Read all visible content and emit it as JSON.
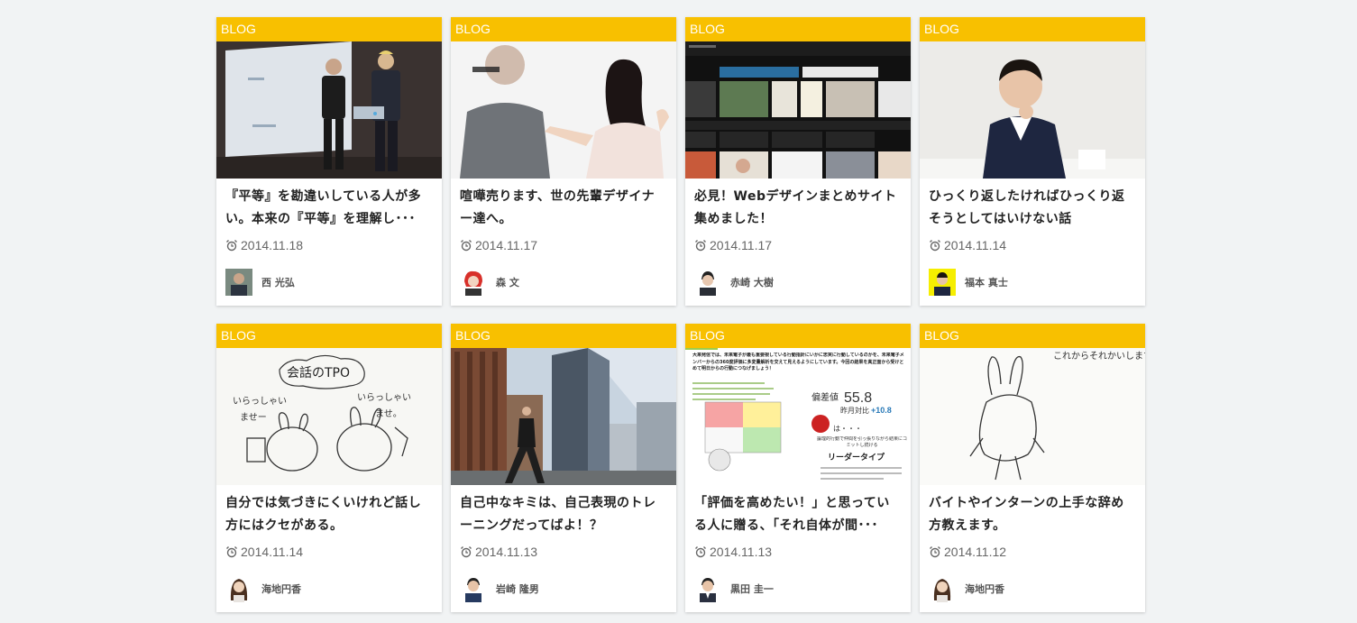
{
  "cards": [
    {
      "category": "BLOG",
      "title": "『平等』を勘違いしている人が多い。本来の『平等』を理解し･･･",
      "date": "2014.11.18",
      "author": "西 光弘",
      "thumb_icon": "presentation-photo"
    },
    {
      "category": "BLOG",
      "title": "喧嘩売ります、世の先輩デザイナー達へ。",
      "date": "2014.11.17",
      "author": "森 文",
      "thumb_icon": "argument-photo"
    },
    {
      "category": "BLOG",
      "title": "必見！Webデザインまとめサイト集めました！",
      "date": "2014.11.17",
      "author": "赤崎 大樹",
      "thumb_icon": "website-screenshot"
    },
    {
      "category": "BLOG",
      "title": "ひっくり返したければひっくり返そうとしてはいけない話",
      "date": "2014.11.14",
      "author": "福本 真士",
      "thumb_icon": "portrait-photo"
    },
    {
      "category": "BLOG",
      "title": "自分では気づきにくいけれど話し方にはクセがある。",
      "date": "2014.11.14",
      "author": "海地円香",
      "thumb_icon": "sketch-illustration",
      "thumb_text": [
        "会話のTPO",
        "いらっしゃい",
        "ませー",
        "いらっしゃい",
        "ませ。"
      ]
    },
    {
      "category": "BLOG",
      "title": "自己中なキミは、自己表現のトレーニングだってばよ！？",
      "date": "2014.11.13",
      "author": "岩崎 隆男",
      "thumb_icon": "city-building-photo"
    },
    {
      "category": "BLOG",
      "title": "「評価を高めたい！」と思っている人に贈る、「それ自体が間･･･",
      "date": "2014.11.13",
      "author": "黒田 圭一",
      "thumb_icon": "evaluation-report",
      "thumb_text": [
        "大来発信では、未来電子が最も重要視している行動指針にいかに忠実に行動しているのかを、未来電子メンバーからの360度評価に多変量解析を交えて見えるようにしています。今回の結果を真正面から受けとめて明日からの行動につなげましょう！",
        "偏差値",
        "55.8",
        "昨月対比",
        "+10.8",
        "は・・・",
        "論理的行動で仲間を引っ張りながら結果にコミットし続ける",
        "リーダータイプ"
      ]
    },
    {
      "category": "BLOG",
      "title": "バイトやインターンの上手な辞め方教えます。",
      "date": "2014.11.12",
      "author": "海地円香",
      "thumb_icon": "rabbit-sketch",
      "thumb_text": [
        "これからそれかいします。"
      ]
    }
  ],
  "colors": {
    "category_bg": "#f8c000",
    "page_bg": "#f1f3f4"
  }
}
